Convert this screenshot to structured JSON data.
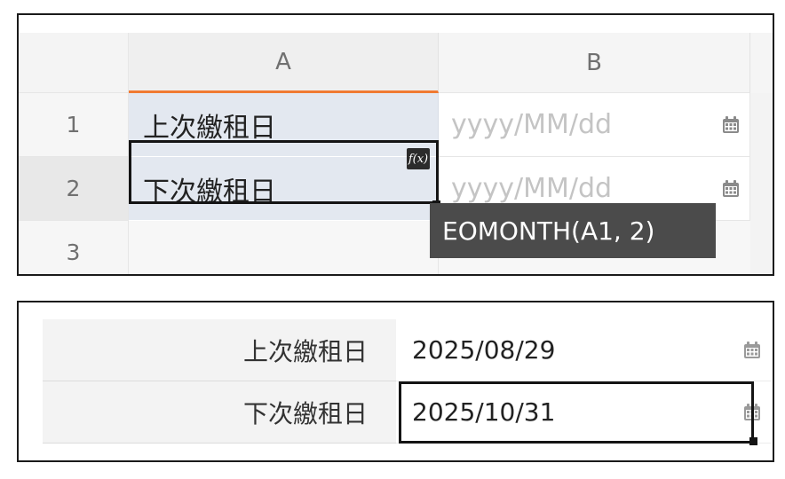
{
  "sheet": {
    "columns": [
      "A",
      "B"
    ],
    "rows": [
      "1",
      "2",
      "3"
    ],
    "a1": "上次繳租日",
    "a2": "下次繳租日",
    "b1_placeholder": "yyyy/MM/dd",
    "b2_placeholder": "yyyy/MM/dd",
    "fx_badge": "f(x)",
    "formula_tooltip": "EOMONTH(A1, 2)",
    "accent_color": "#f07a32"
  },
  "form": {
    "rows": [
      {
        "label": "上次繳租日",
        "value": "2025/08/29"
      },
      {
        "label": "下次繳租日",
        "value": "2025/10/31"
      }
    ]
  },
  "icons": {
    "date": "calendar-icon"
  }
}
